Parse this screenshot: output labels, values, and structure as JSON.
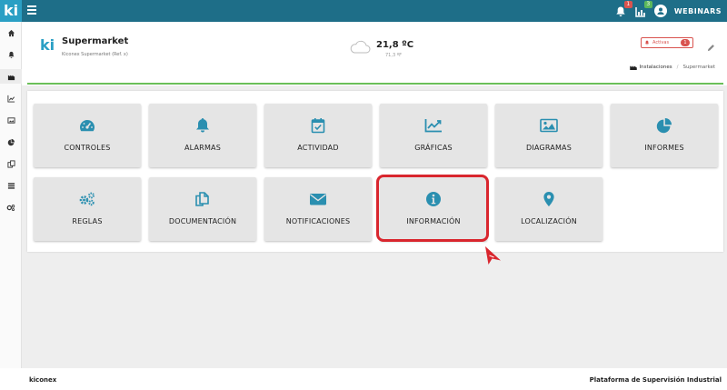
{
  "topbar": {
    "logo": "ki",
    "notif_badge": "1",
    "chart_badge": "3",
    "user_label": "WEBINARS"
  },
  "site": {
    "brand": "ki",
    "name": "Supermarket",
    "subtitle": "Kiconex Supermarket (Ref. x)",
    "temperature": "21,8 ºC",
    "temperature_sub": "71,3 ºF",
    "alarm_label": "Activas",
    "alarm_count": "1",
    "breadcrumb_root": "Instalaciones",
    "breadcrumb_sep": "/",
    "breadcrumb_current": "Supermarket"
  },
  "tiles": [
    {
      "label": "CONTROLES",
      "icon": "dashboard-icon"
    },
    {
      "label": "ALARMAS",
      "icon": "bell-icon"
    },
    {
      "label": "ACTIVIDAD",
      "icon": "calendar-check-icon"
    },
    {
      "label": "GRÁFICAS",
      "icon": "line-chart-icon"
    },
    {
      "label": "DIAGRAMAS",
      "icon": "image-icon"
    },
    {
      "label": "INFORMES",
      "icon": "pie-chart-icon"
    },
    {
      "label": "REGLAS",
      "icon": "gears-icon"
    },
    {
      "label": "DOCUMENTACIÓN",
      "icon": "copy-icon"
    },
    {
      "label": "NOTIFICACIONES",
      "icon": "envelope-icon"
    },
    {
      "label": "INFORMACIÓN",
      "icon": "info-circle-icon"
    },
    {
      "label": "LOCALIZACIÓN",
      "icon": "map-marker-icon"
    }
  ],
  "footer": {
    "left": "kiconex",
    "right": "Plataforma de Supervisión Industrial"
  },
  "colors": {
    "topbar": "#1e6e88",
    "accent": "#2a9fc4",
    "alert": "#d9534f",
    "success": "#6bbf59"
  }
}
